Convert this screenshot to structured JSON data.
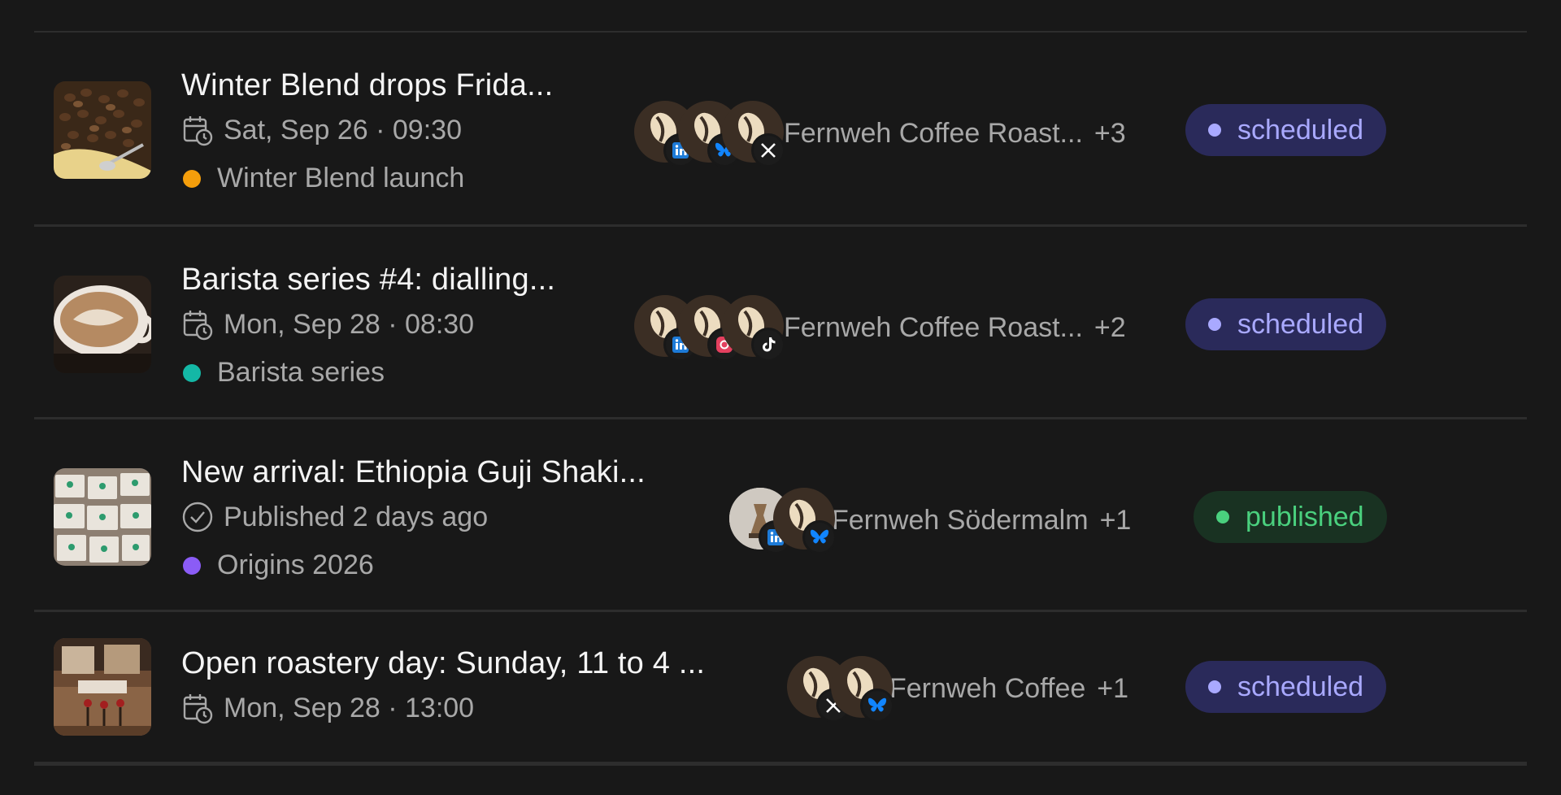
{
  "posts": [
    {
      "title": "Winter Blend drops Frida...",
      "when": "Sat, Sep 26 · 09:30",
      "when_icon": "calendar-clock-icon",
      "campaign": "Winter Blend launch",
      "campaign_color": "#f59e0b",
      "account_label": "Fernweh Coffee Roast...",
      "account_extra": "+3",
      "avatar_badges": [
        "linkedin-icon",
        "bluesky-icon",
        "x-icon"
      ],
      "status": "scheduled",
      "thumb": "coffee-beans-image"
    },
    {
      "title": "Barista series #4: dialling...",
      "when": "Mon, Sep 28 · 08:30",
      "when_icon": "calendar-clock-icon",
      "campaign": "Barista series",
      "campaign_color": "#14b8a6",
      "account_label": "Fernweh Coffee Roast...",
      "account_extra": "+2",
      "avatar_badges": [
        "linkedin-icon",
        "instagram-icon",
        "tiktok-icon"
      ],
      "status": "scheduled",
      "thumb": "latte-cup-image"
    },
    {
      "title": "New arrival: Ethiopia Guji Shaki...",
      "when": "Published 2 days ago",
      "when_icon": "check-circle-icon",
      "campaign": "Origins 2026",
      "campaign_color": "#8b5cf6",
      "account_label": "Fernweh Södermalm",
      "account_extra": "+1",
      "avatar_badges": [
        "linkedin-icon",
        "bluesky-icon"
      ],
      "status": "published",
      "thumb": "coffee-bags-image"
    },
    {
      "title": "Open roastery day: Sunday, 11 to 4 ...",
      "when": "Mon, Sep 28 · 13:00",
      "when_icon": "calendar-clock-icon",
      "campaign": "",
      "account_label": "Fernweh Coffee",
      "account_extra": "+1",
      "avatar_badges": [
        "x-icon",
        "bluesky-icon"
      ],
      "status": "scheduled",
      "thumb": "cafe-interior-image"
    }
  ],
  "colors": {
    "background": "#181818",
    "scheduled_bg": "#2a2a5a",
    "scheduled_fg": "#a9a9ff",
    "published_bg": "#193222",
    "published_fg": "#4ad07e"
  }
}
